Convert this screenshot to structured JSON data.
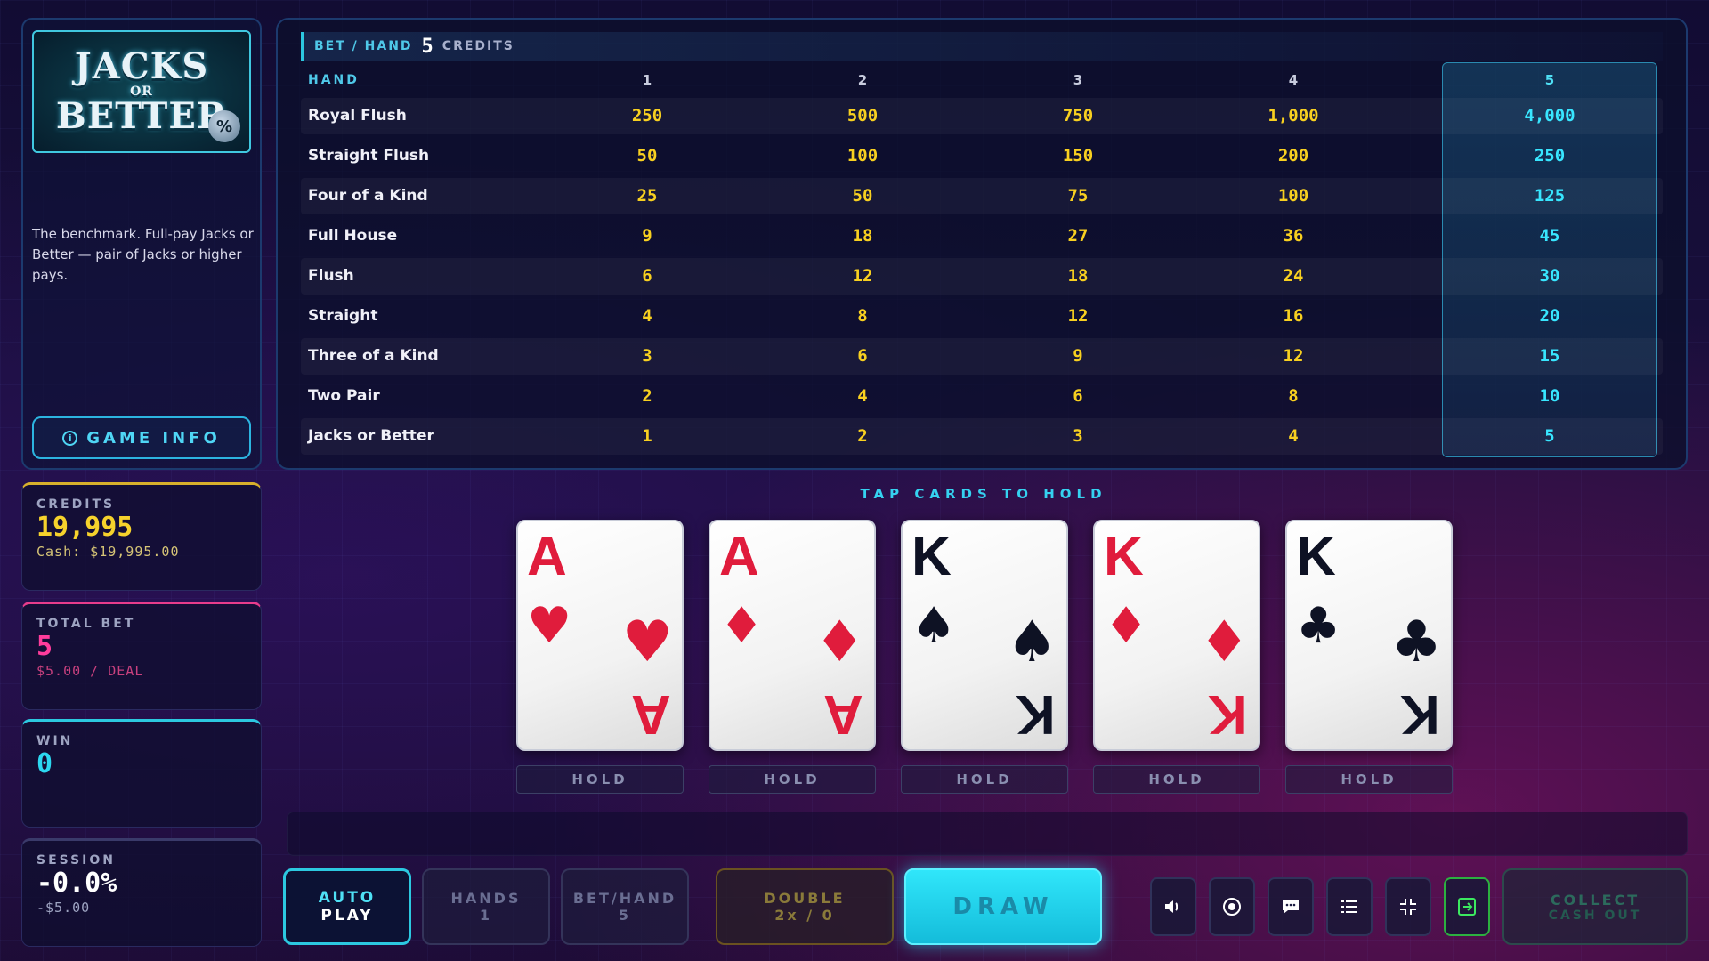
{
  "logo": {
    "line1": "JACKS",
    "line2": "OR",
    "line3": "BETTER",
    "badge": "%"
  },
  "description": "The benchmark. Full-pay Jacks or Better — pair of Jacks or higher pays.",
  "game_info_label": "GAME INFO",
  "stats": {
    "credits": {
      "label": "CREDITS",
      "value": "19,995",
      "sub": "Cash: $19,995.00"
    },
    "total_bet": {
      "label": "TOTAL BET",
      "value": "5",
      "sub": "$5.00 / DEAL"
    },
    "win": {
      "label": "WIN",
      "value": "0"
    },
    "session": {
      "label": "SESSION",
      "value": "-0.0%",
      "sub": "-$5.00"
    }
  },
  "bet_bar": {
    "label": "BET / HAND",
    "value": "5",
    "unit": "CREDITS"
  },
  "paytable": {
    "hand_header": "HAND",
    "columns": [
      "1",
      "2",
      "3",
      "4",
      "5"
    ],
    "rows": [
      {
        "name": "Royal Flush",
        "values": [
          "250",
          "500",
          "750",
          "1,000",
          "4,000"
        ]
      },
      {
        "name": "Straight Flush",
        "values": [
          "50",
          "100",
          "150",
          "200",
          "250"
        ]
      },
      {
        "name": "Four of a Kind",
        "values": [
          "25",
          "50",
          "75",
          "100",
          "125"
        ]
      },
      {
        "name": "Full House",
        "values": [
          "9",
          "18",
          "27",
          "36",
          "45"
        ]
      },
      {
        "name": "Flush",
        "values": [
          "6",
          "12",
          "18",
          "24",
          "30"
        ]
      },
      {
        "name": "Straight",
        "values": [
          "4",
          "8",
          "12",
          "16",
          "20"
        ]
      },
      {
        "name": "Three of a Kind",
        "values": [
          "3",
          "6",
          "9",
          "12",
          "15"
        ]
      },
      {
        "name": "Two Pair",
        "values": [
          "2",
          "4",
          "6",
          "8",
          "10"
        ]
      },
      {
        "name": "Jacks or Better",
        "values": [
          "1",
          "2",
          "3",
          "4",
          "5"
        ]
      }
    ]
  },
  "tap_hint": "TAP CARDS TO HOLD",
  "cards": [
    {
      "rank": "A",
      "suit": "♥",
      "color": "red"
    },
    {
      "rank": "A",
      "suit": "♦",
      "color": "red"
    },
    {
      "rank": "K",
      "suit": "♠",
      "color": "black"
    },
    {
      "rank": "K",
      "suit": "♦",
      "color": "red"
    },
    {
      "rank": "K",
      "suit": "♣",
      "color": "black"
    }
  ],
  "hold_label": "HOLD",
  "buttons": {
    "auto_play": {
      "l1": "AUTO",
      "l2": "PLAY"
    },
    "hands": {
      "l1": "HANDS",
      "l2": "1"
    },
    "bet_hand": {
      "l1": "BET/HAND",
      "l2": "5"
    },
    "double": {
      "l1": "DOUBLE",
      "l2": "2x / 0"
    },
    "draw": "DRAW",
    "collect": {
      "l1": "COLLECT",
      "l2": "CASH OUT"
    }
  },
  "icons": [
    "volume-icon",
    "record-icon",
    "chat-icon",
    "list-icon",
    "collapse-icon",
    "exit-icon"
  ],
  "colors": {
    "accent": "#2cc8e0",
    "credits": "#f6d22c",
    "bet": "#ff3c9c",
    "paytable_value": "#f8d020",
    "active_column": "#38e6ff"
  }
}
